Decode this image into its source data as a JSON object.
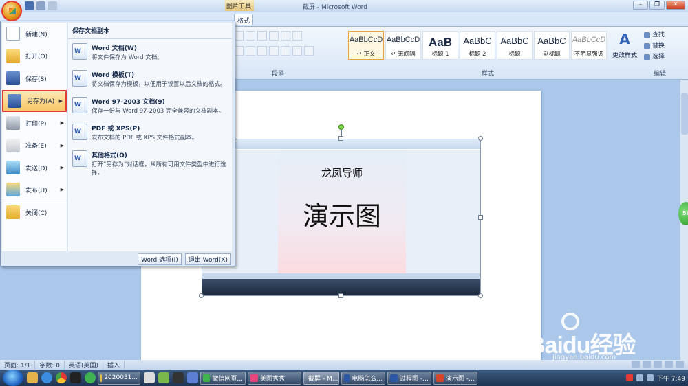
{
  "window": {
    "title": "截屏 - Microsoft Word",
    "context_tab": "图片工具",
    "minimize": "–",
    "restore": "❐",
    "close": "✕"
  },
  "ribbon": {
    "tab_visible": "格式",
    "paragraph_group": "段落",
    "styles_group": "样式",
    "editing_group": "编辑",
    "styles": [
      {
        "preview": "AaBbCcD",
        "name": "↵ 正文"
      },
      {
        "preview": "AaBbCcD",
        "name": "↵ 无间隔"
      },
      {
        "preview": "AaB",
        "name": "标题 1"
      },
      {
        "preview": "AaBbC",
        "name": "标题 2"
      },
      {
        "preview": "AaBbC",
        "name": "标题"
      },
      {
        "preview": "AaBbC",
        "name": "副标题"
      },
      {
        "preview": "AaBbCcD",
        "name": "不明显强调"
      }
    ],
    "change_styles": "更改样式",
    "edit": {
      "find": "查找",
      "replace": "替换",
      "select": "选择"
    }
  },
  "office_menu": {
    "items": [
      {
        "label": "新建(N)",
        "icon": "new-doc-icon"
      },
      {
        "label": "打开(O)",
        "icon": "open-folder-icon"
      },
      {
        "label": "保存(S)",
        "icon": "save-icon"
      },
      {
        "label": "另存为(A)",
        "icon": "save-as-icon"
      },
      {
        "label": "打印(P)",
        "icon": "print-icon"
      },
      {
        "label": "准备(E)",
        "icon": "prepare-icon"
      },
      {
        "label": "发送(D)",
        "icon": "send-icon"
      },
      {
        "label": "发布(U)",
        "icon": "publish-icon"
      },
      {
        "label": "关闭(C)",
        "icon": "close-folder-icon"
      }
    ],
    "right_header": "保存文档副本",
    "entries": [
      {
        "title": "Word 文档(W)",
        "desc": "将文件保存为 Word 文档。"
      },
      {
        "title": "Word 模板(T)",
        "desc": "将文档保存为模板，以便用于设置以后文档的格式。"
      },
      {
        "title": "Word 97-2003 文档(9)",
        "desc": "保存一份与 Word 97-2003 完全兼容的文档副本。"
      },
      {
        "title": "PDF 或 XPS(P)",
        "desc": "发布文档的 PDF 或 XPS 文件格式副本。"
      },
      {
        "title": "其他格式(O)",
        "desc": "打开“另存为”对话框，从所有可用文件类型中进行选择。"
      }
    ],
    "word_options": "Word 选项(I)",
    "exit_word": "退出 Word(X)"
  },
  "document": {
    "image_subtitle": "龙凤导师",
    "image_title": "演示图"
  },
  "statusbar": {
    "page": "页面: 1/1",
    "words": "字数: 0",
    "language": "英语(美国)",
    "mode": "插入"
  },
  "taskbar": {
    "tasks": [
      "2020031...",
      "微信网页...",
      "美图秀秀",
      "截屏 - M...",
      "电脑怎么...",
      "过程图 -...",
      "演示图 -..."
    ],
    "clock": "下午 7:49"
  },
  "watermark": {
    "brand": "Baidu经验",
    "url": "jingyan.baidu.com"
  },
  "colors": {
    "highlight_border": "#e53935",
    "menu_highlight": "#f8c768",
    "ribbon_blue": "#c5daf3"
  }
}
